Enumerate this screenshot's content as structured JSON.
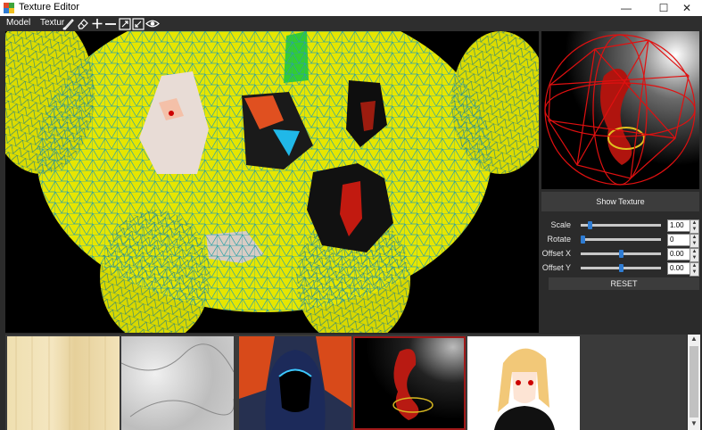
{
  "window": {
    "title": "Texture Editor",
    "minimize": "—",
    "maximize": "☐",
    "close": "✕"
  },
  "menu": {
    "model": "Model",
    "texture": "Textur"
  },
  "toolbar": {
    "icons": [
      "brush-icon",
      "eraser-icon",
      "add-icon",
      "minus-icon",
      "expand-icon",
      "collapse-icon",
      "eye-icon"
    ]
  },
  "panel": {
    "show_texture": "Show Texture",
    "controls": [
      {
        "label": "Scale",
        "value": "1.00",
        "slider": 0.1
      },
      {
        "label": "Rotate",
        "value": "0",
        "slider": 0.0
      },
      {
        "label": "Offset X",
        "value": "0.00",
        "slider": 0.5
      },
      {
        "label": "Offset Y",
        "value": "0.00",
        "slider": 0.5
      }
    ],
    "reset": "RESET"
  },
  "gallery": {
    "thumbnails": [
      "wood-texture",
      "marble-texture",
      "hooded-figure-art",
      "dragon-render",
      "anime-girl-art"
    ],
    "selected_index": 3
  },
  "colors": {
    "viewport_mesh": "#e6e600",
    "wire": "#2aa0a8",
    "preview_wire": "#e01010",
    "accent": "#2f7cd3"
  }
}
